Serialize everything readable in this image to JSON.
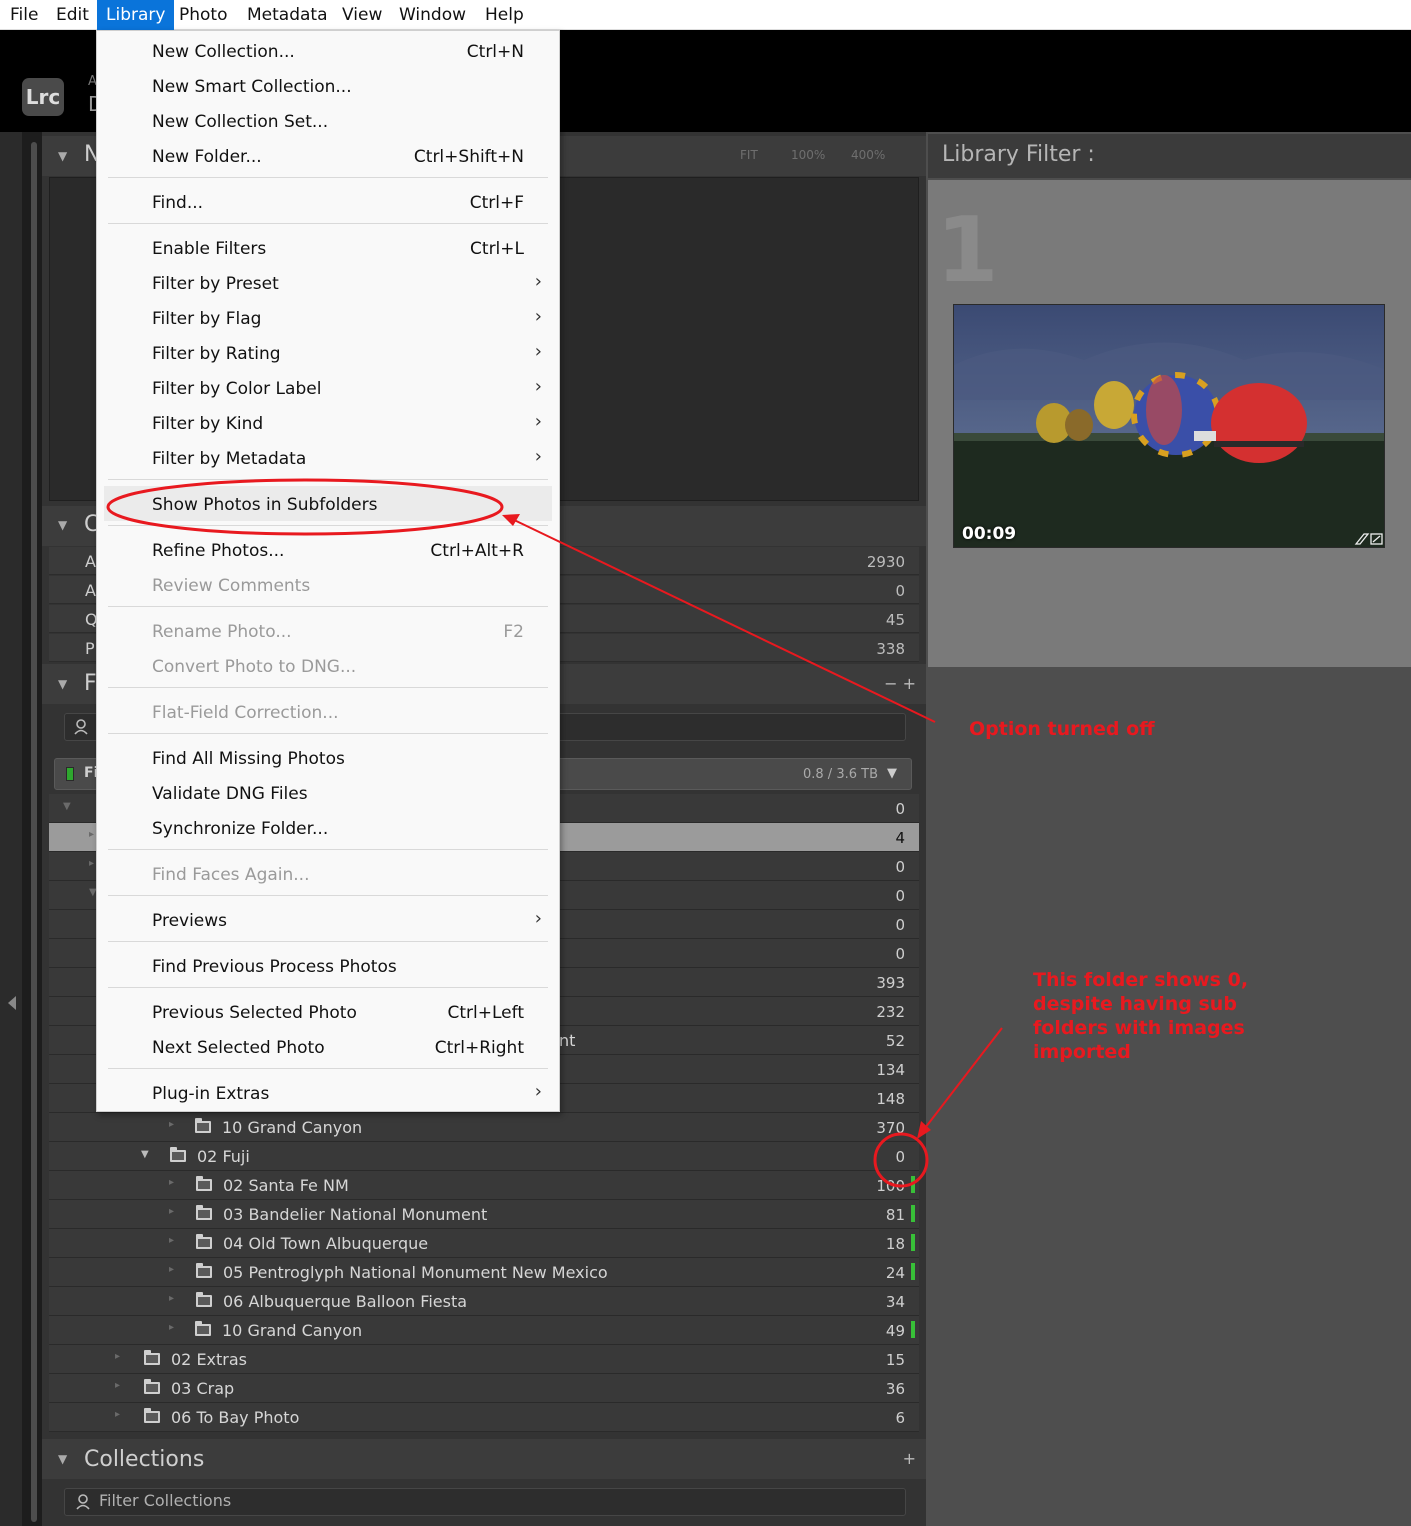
{
  "menubar": {
    "items": [
      "File",
      "Edit",
      "Library",
      "Photo",
      "Metadata",
      "View",
      "Window",
      "Help"
    ],
    "active": "Library"
  },
  "app": {
    "logo": "Lrc",
    "identity_fragment_1": "A",
    "identity_fragment_2": "D"
  },
  "navigator": {
    "title_fragment": "N",
    "zoom_options": [
      "FIT",
      "100%",
      "400%"
    ]
  },
  "catalog": {
    "title_fragment": "C",
    "rows": [
      {
        "label_fragment": "A",
        "count": "2930"
      },
      {
        "label_fragment": "A",
        "count": "0"
      },
      {
        "label_fragment": "Q",
        "count": "45"
      },
      {
        "label_fragment": "P",
        "count": "338"
      }
    ]
  },
  "folders": {
    "title_fragment": "F",
    "header_icons": "− +",
    "volume": {
      "name_fragment": "Fi",
      "size": "0.8 / 3.6 TB"
    },
    "hidden_row_counts": [
      "0",
      "4",
      "0",
      "0",
      "0",
      "0",
      "393",
      "232",
      "52",
      "134",
      "148"
    ],
    "hidden_row_text_fragment": "nt",
    "visible_rows": [
      {
        "name": "10 Grand Canyon",
        "count": "370"
      },
      {
        "name": "02 Fuji",
        "count": "0"
      },
      {
        "name": "02 Santa Fe NM",
        "count": "100"
      },
      {
        "name": "03 Bandelier National Monument",
        "count": "81"
      },
      {
        "name": "04 Old Town Albuquerque",
        "count": "18"
      },
      {
        "name": "05 Pentroglyph National Monument New Mexico",
        "count": "24"
      },
      {
        "name": "06 Albuquerque Balloon Fiesta",
        "count": "34"
      },
      {
        "name": "10 Grand Canyon",
        "count": "49"
      },
      {
        "name": "02 Extras",
        "count": "15"
      },
      {
        "name": "03 Crap",
        "count": "36"
      },
      {
        "name": "06 To Bay Photo",
        "count": "6"
      }
    ]
  },
  "collections": {
    "title": "Collections",
    "add_icon": "+",
    "search_placeholder": "Filter Collections"
  },
  "library_filter": {
    "title": "Library Filter :",
    "grid_cell_number": "1",
    "video_duration": "00:09"
  },
  "library_menu": {
    "items": [
      {
        "label": "New Collection...",
        "shortcut": "Ctrl+N"
      },
      {
        "label": "New Smart Collection...",
        "shortcut": ""
      },
      {
        "label": "New Collection Set...",
        "shortcut": ""
      },
      {
        "label": "New Folder...",
        "shortcut": "Ctrl+Shift+N"
      },
      {
        "label": "Find...",
        "shortcut": "Ctrl+F"
      },
      {
        "label": "Enable Filters",
        "shortcut": "Ctrl+L"
      },
      {
        "label": "Filter by Preset",
        "shortcut": ""
      },
      {
        "label": "Filter by Flag",
        "shortcut": ""
      },
      {
        "label": "Filter by Rating",
        "shortcut": ""
      },
      {
        "label": "Filter by Color Label",
        "shortcut": ""
      },
      {
        "label": "Filter by Kind",
        "shortcut": ""
      },
      {
        "label": "Filter by Metadata",
        "shortcut": ""
      },
      {
        "label": "Show Photos in Subfolders",
        "shortcut": ""
      },
      {
        "label": "Refine Photos...",
        "shortcut": "Ctrl+Alt+R"
      },
      {
        "label": "Review Comments",
        "shortcut": ""
      },
      {
        "label": "Rename Photo...",
        "shortcut": "F2"
      },
      {
        "label": "Convert Photo to DNG...",
        "shortcut": ""
      },
      {
        "label": "Flat-Field Correction...",
        "shortcut": ""
      },
      {
        "label": "Find All Missing Photos",
        "shortcut": ""
      },
      {
        "label": "Validate DNG Files",
        "shortcut": ""
      },
      {
        "label": "Synchronize Folder...",
        "shortcut": ""
      },
      {
        "label": "Find Faces Again...",
        "shortcut": ""
      },
      {
        "label": "Previews",
        "shortcut": ""
      },
      {
        "label": "Find Previous Process Photos",
        "shortcut": ""
      },
      {
        "label": "Previous Selected Photo",
        "shortcut": "Ctrl+Left"
      },
      {
        "label": "Next Selected Photo",
        "shortcut": "Ctrl+Right"
      },
      {
        "label": "Plug-in Extras",
        "shortcut": ""
      }
    ],
    "submenu_glyph": "›"
  },
  "annotations": {
    "option_off": "Option turned off",
    "folder_note_lines": [
      "This folder shows 0,",
      "despite having sub",
      "folders with images",
      "imported"
    ],
    "color": "#e8191f"
  }
}
